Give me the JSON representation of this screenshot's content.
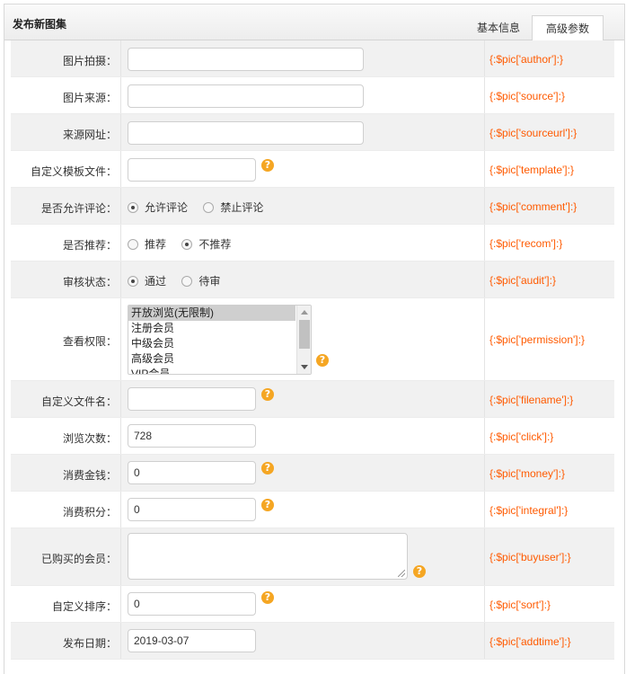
{
  "header": {
    "title": "发布新图集",
    "tabs": [
      "基本信息",
      "高级参数"
    ],
    "active_tab": "高级参数"
  },
  "fields": {
    "author": {
      "label": "图片拍摄：",
      "value": "",
      "code": "{:$pic['author']:}"
    },
    "source": {
      "label": "图片来源：",
      "value": "",
      "code": "{:$pic['source']:}"
    },
    "sourceurl": {
      "label": "来源网址：",
      "value": "",
      "code": "{:$pic['sourceurl']:}"
    },
    "template": {
      "label": "自定义模板文件：",
      "value": "",
      "code": "{:$pic['template']:}"
    },
    "comment": {
      "label": "是否允许评论：",
      "options": [
        "允许评论",
        "禁止评论"
      ],
      "selected": "允许评论",
      "code": "{:$pic['comment']:}"
    },
    "recom": {
      "label": "是否推荐：",
      "options": [
        "推荐",
        "不推荐"
      ],
      "selected": "不推荐",
      "code": "{:$pic['recom']:}"
    },
    "audit": {
      "label": "审核状态：",
      "options": [
        "通过",
        "待审"
      ],
      "selected": "通过",
      "code": "{:$pic['audit']:}"
    },
    "permission": {
      "label": "查看权限：",
      "options": [
        "开放浏览(无限制)",
        "注册会员",
        "中级会员",
        "高级会员",
        "VIP会员"
      ],
      "selected": "开放浏览(无限制)",
      "code": "{:$pic['permission']:}"
    },
    "filename": {
      "label": "自定义文件名：",
      "value": "",
      "code": "{:$pic['filename']:}"
    },
    "click": {
      "label": "浏览次数：",
      "value": "728",
      "code": "{:$pic['click']:}"
    },
    "money": {
      "label": "消费金钱：",
      "value": "0",
      "code": "{:$pic['money']:}"
    },
    "integral": {
      "label": "消费积分：",
      "value": "0",
      "code": "{:$pic['integral']:}"
    },
    "buyuser": {
      "label": "已购买的会员：",
      "value": "",
      "code": "{:$pic['buyuser']:}"
    },
    "sort": {
      "label": "自定义排序：",
      "value": "0",
      "code": "{:$pic['sort']:}"
    },
    "addtime": {
      "label": "发布日期：",
      "value": "2019-03-07",
      "code": "{:$pic['addtime']:}"
    }
  },
  "icons": {
    "help": "help-icon"
  },
  "colors": {
    "code": "#ff5a00",
    "help": "#f5a623",
    "alt_row": "#f1f1f1"
  }
}
